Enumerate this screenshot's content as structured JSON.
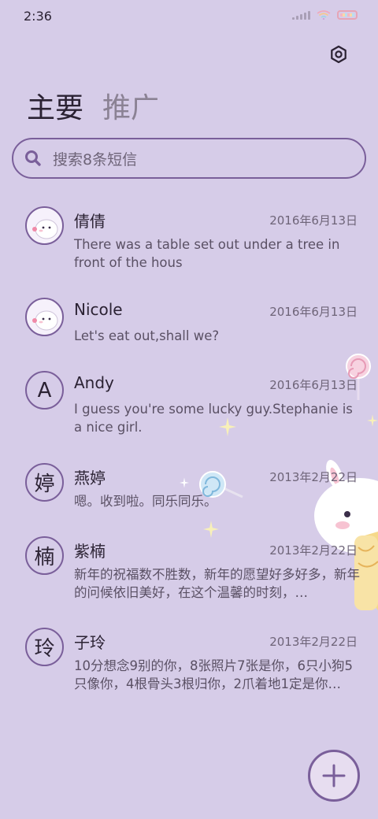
{
  "status_bar": {
    "time": "2:36"
  },
  "tabs": [
    {
      "label": "主要",
      "active": true
    },
    {
      "label": "推广",
      "active": false
    }
  ],
  "search": {
    "placeholder": "搜索8条短信"
  },
  "conversations": [
    {
      "name": "倩倩",
      "date": "2016年6月13日",
      "snippet": "There was a table set out under a tree in front of the hous",
      "avatar": "cartoon-avatar",
      "avatar_text": ""
    },
    {
      "name": "Nicole",
      "date": "2016年6月13日",
      "snippet": "Let's eat out,shall we?",
      "avatar": "cartoon-avatar",
      "avatar_text": ""
    },
    {
      "name": "Andy",
      "date": "2016年6月13日",
      "snippet": "I guess you're some lucky guy.Stephanie is a nice girl.",
      "avatar": "letter",
      "avatar_text": "A"
    },
    {
      "name": "燕婷",
      "date": "2013年2月22日",
      "snippet": "嗯。收到啦。同乐同乐。",
      "avatar": "letter",
      "avatar_text": "婷"
    },
    {
      "name": "紫楠",
      "date": "2013年2月22日",
      "snippet": "新年的祝福数不胜数，新年的愿望好多好多，新年的问候依旧美好，在这个温馨的时刻，…",
      "avatar": "letter",
      "avatar_text": "楠"
    },
    {
      "name": "子玲",
      "date": "2013年2月22日",
      "snippet": "10分想念9别的你，8张照片7张是你，6只小狗5只像你，4根骨头3根归你，2爪着地1定是你…",
      "avatar": "letter",
      "avatar_text": "玲"
    }
  ],
  "fab": {
    "icon": "plus-icon"
  },
  "colors": {
    "background": "#d6cce8",
    "accent": "#7a5f9a"
  }
}
